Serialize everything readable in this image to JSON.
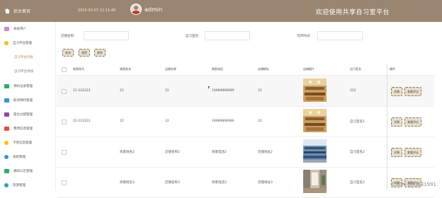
{
  "header": {
    "home_label": "后台首页",
    "datetime": "2024-02-07 11:11:40",
    "username": "admin",
    "platform_title": "欢迎使用共享自习室平台"
  },
  "sidebar": {
    "items": [
      {
        "label": "系统用户",
        "icon": "users-icon",
        "color": "#c98bd9"
      },
      {
        "label": "自习平台管理",
        "icon": "circle-icon",
        "color": "#f1c40f"
      },
      {
        "label": "自习平台列表",
        "sub": true,
        "active": true
      },
      {
        "label": "自习平台添加",
        "sub": true
      },
      {
        "label": "预约记录管理",
        "icon": "record-icon",
        "color": "#27ae60"
      },
      {
        "label": "取消预约管理",
        "icon": "cancel-icon",
        "color": "#3498db"
      },
      {
        "label": "座位分配管理",
        "icon": "seat-icon",
        "color": "#8e44ad"
      },
      {
        "label": "费用信息管理",
        "icon": "fee-icon",
        "color": "#e74c3c"
      },
      {
        "label": "卡券信息管理",
        "icon": "coupon-icon",
        "color": "#f1c40f"
      },
      {
        "label": "系统管理",
        "icon": "gear-icon",
        "color": "#3498db"
      },
      {
        "label": "通知公告管理",
        "icon": "notice-icon",
        "color": "#27ae60"
      },
      {
        "label": "资源管理",
        "icon": "resource-icon",
        "color": "#3498db"
      }
    ]
  },
  "filters": {
    "store_name_label": "店铺名称:",
    "room_name_label": "自习室名:",
    "open_time_label": "可开时间:"
  },
  "buttons": {
    "search": "查询",
    "reset": "重置",
    "delete": "删除"
  },
  "table": {
    "headers": [
      "商家账号",
      "商家姓名",
      "店铺名称",
      "商家电话",
      "店铺地址",
      "店铺图片",
      "自习室名",
      "操作"
    ],
    "rows": [
      {
        "account": "22-222222",
        "name": "22",
        "store": "22",
        "phone": "18989898989",
        "address": "22",
        "room": "222",
        "image": "study-room-photo"
      },
      {
        "account": "22-222222",
        "name": "22",
        "store": "22",
        "phone": "18989898989",
        "address": "22",
        "room": "自习室名1",
        "image": "study-room-photo"
      },
      {
        "account": "",
        "name": "商家姓名2",
        "store": "店铺名称2",
        "phone": "商家电话2",
        "address": "店铺地址2",
        "room": "自习室名2",
        "image": "classroom-photo"
      },
      {
        "account": "",
        "name": "商家姓名3",
        "store": "店铺名称3",
        "phone": "商家电话3",
        "address": "店铺地址3",
        "room": "自习室名3",
        "image": "hallway-photo"
      }
    ],
    "actions": {
      "detail": "详情",
      "review": "查看评论"
    }
  },
  "watermark": "CSDN @KJB31991"
}
